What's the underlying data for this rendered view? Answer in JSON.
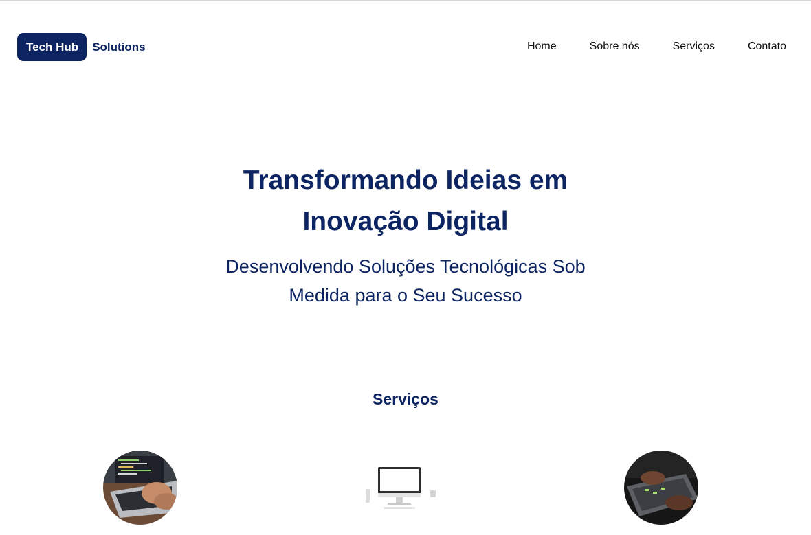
{
  "brand": {
    "badge": "Tech Hub",
    "text": "Solutions",
    "color": "#0c2461"
  },
  "nav": {
    "items": [
      {
        "label": "Home"
      },
      {
        "label": "Sobre nós"
      },
      {
        "label": "Serviços"
      },
      {
        "label": "Contato"
      }
    ]
  },
  "hero": {
    "title": "Transformando Ideias em Inovação Digital",
    "subtitle": "Desenvolvendo Soluções Tecnológicas Sob Medida para o Seu Sucesso"
  },
  "services": {
    "title": "Serviços",
    "images": [
      {
        "icon": "laptop-coding-photo"
      },
      {
        "icon": "desktop-computer-photo"
      },
      {
        "icon": "typing-laptop-photo"
      }
    ]
  }
}
